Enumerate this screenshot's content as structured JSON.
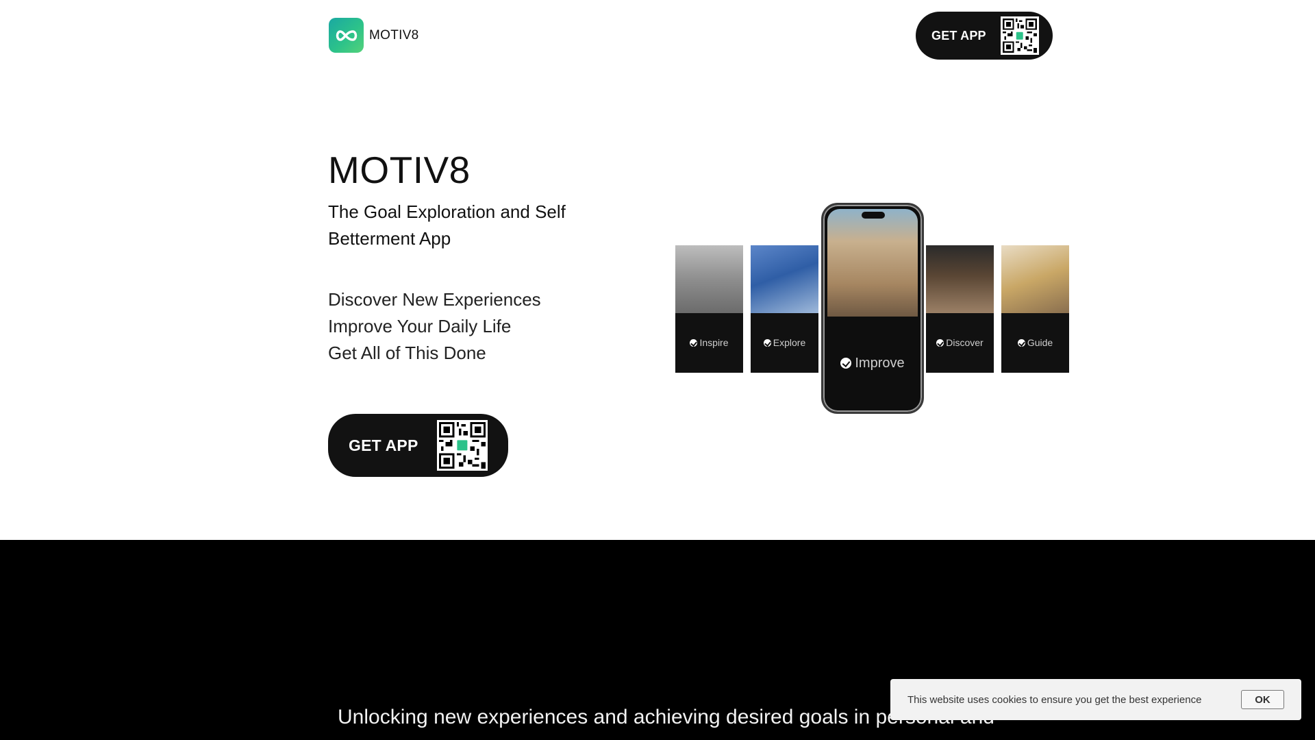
{
  "header": {
    "brand": "MOTIV8",
    "get_app_label": "GET APP"
  },
  "hero": {
    "title": "MOTIV8",
    "subtitle": "The Goal Exploration and Self Betterment App",
    "lines": [
      "Discover New Experiences",
      "Improve Your Daily Life",
      "Get All of This Done"
    ],
    "get_app_label": "GET APP"
  },
  "showcase": {
    "cards": [
      "Inspire",
      "Explore",
      "Improve",
      "Discover",
      "Guide"
    ]
  },
  "band": {
    "tagline": "Unlocking new experiences and achieving desired goals in personal and"
  },
  "cookie": {
    "message": "This website uses cookies to ensure you get the best experience",
    "ok_label": "OK"
  },
  "colors": {
    "brand_gradient_start": "#1aa8a2",
    "brand_gradient_end": "#54d27a",
    "button_bg": "#121212",
    "band_bg": "#000000"
  }
}
